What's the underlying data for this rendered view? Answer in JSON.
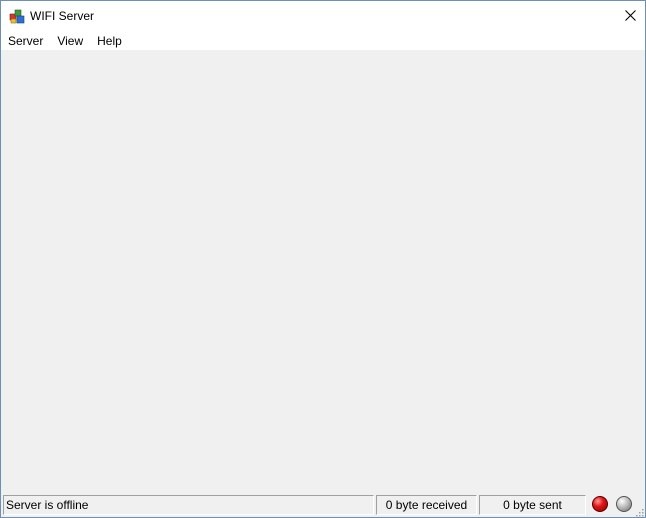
{
  "window": {
    "title": "WIFI Server",
    "icon": "cubes-app-icon",
    "close_icon": "close-icon"
  },
  "menu": {
    "items": [
      {
        "label": "Server"
      },
      {
        "label": "View"
      },
      {
        "label": "Help"
      }
    ]
  },
  "statusbar": {
    "status_text": "Server is offline",
    "received_text": "0 byte received",
    "sent_text": "0 byte sent",
    "indicators": [
      {
        "name": "red-led-icon",
        "color": "#e21414"
      },
      {
        "name": "gray-led-icon",
        "color": "#bdbdbd"
      }
    ]
  },
  "colors": {
    "client_background": "#f0f0f0",
    "window_border": "#6b8fb5"
  }
}
